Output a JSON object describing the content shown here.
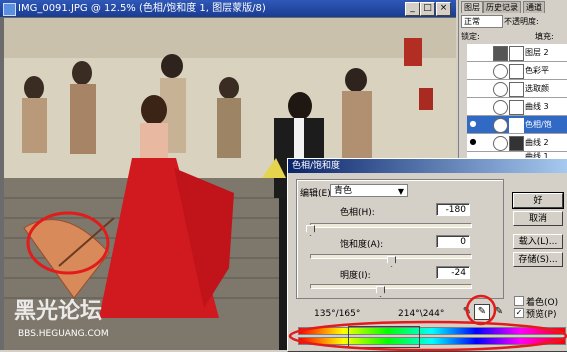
{
  "document": {
    "title": "IMG_0091.JPG @ 12.5% (色相/饱和度 1, 图层蒙版/8)",
    "watermark_domain": "BBS.HEGUANG.COM"
  },
  "panels": {
    "tabs": [
      "图层",
      "历史记录",
      "通道"
    ],
    "blend_mode": "正常",
    "opacity_label": "不透明度:",
    "lock_label": "锁定:",
    "fill_label": "填充:",
    "layers": [
      {
        "label": "图层 2"
      },
      {
        "label": "色彩平"
      },
      {
        "label": "选取颜"
      },
      {
        "label": "曲线 3"
      },
      {
        "label": "色相/饱"
      },
      {
        "label": "曲线 2"
      },
      {
        "label": "曲线 1"
      }
    ]
  },
  "dialog": {
    "title": "色相/饱和度",
    "edit_label": "编辑(E):",
    "edit_value": "青色",
    "hue_label": "色相(H):",
    "hue_value": "-180",
    "saturation_label": "饱和度(A):",
    "saturation_value": "0",
    "lightness_label": "明度(I):",
    "lightness_value": "-24",
    "range_left": "135°/165°",
    "range_right": "214°\\244°",
    "ok": "好",
    "cancel": "取消",
    "load": "载入(L)...",
    "save": "存储(S)...",
    "colorize": "着色(O)",
    "preview": "预览(P)"
  }
}
